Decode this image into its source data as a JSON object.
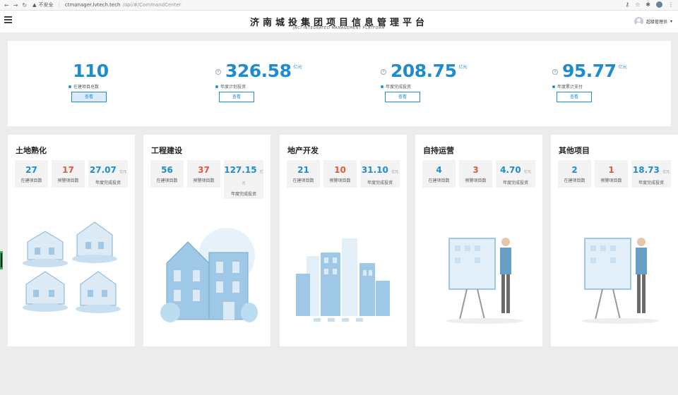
{
  "browser": {
    "insecure_label": "不安全",
    "url_host": "ctmanager.lvtech.tech",
    "url_path": "/api/#/CommandCenter"
  },
  "header": {
    "title_cn": "济南城投集团项目信息管理平台",
    "title_en": "JNCI INTEGRATED MANAGEMENT PLATFORM",
    "user_name": "超级管理员"
  },
  "summary": [
    {
      "value": "110",
      "unit": "",
      "label": "在建项目总数",
      "button": "查看"
    },
    {
      "value": "326.58",
      "unit": "亿元",
      "label": "年度计划投资",
      "button": "查看"
    },
    {
      "value": "208.75",
      "unit": "亿元",
      "label": "年度完成投资",
      "button": "查看"
    },
    {
      "value": "95.77",
      "unit": "亿元",
      "label": "年度累计支付",
      "button": "查看"
    }
  ],
  "cards": [
    {
      "title": "土地熟化",
      "in_progress": "27",
      "warning": "17",
      "completed": "27.07",
      "unit": "亿元"
    },
    {
      "title": "工程建设",
      "in_progress": "56",
      "warning": "37",
      "completed": "127.15",
      "unit": "亿元"
    },
    {
      "title": "地产开发",
      "in_progress": "21",
      "warning": "10",
      "completed": "31.10",
      "unit": "亿元"
    },
    {
      "title": "自持运营",
      "in_progress": "4",
      "warning": "3",
      "completed": "4.70",
      "unit": "亿元"
    },
    {
      "title": "其他项目",
      "in_progress": "2",
      "warning": "1",
      "completed": "18.73",
      "unit": "亿元"
    }
  ],
  "box_labels": {
    "in_progress": "在建项目数",
    "warning": "预警项目数",
    "completed": "年度完成投资"
  },
  "colors": {
    "accent": "#1f8ccf",
    "warning": "#e05a3a",
    "illustration": "#bcdcf0"
  }
}
